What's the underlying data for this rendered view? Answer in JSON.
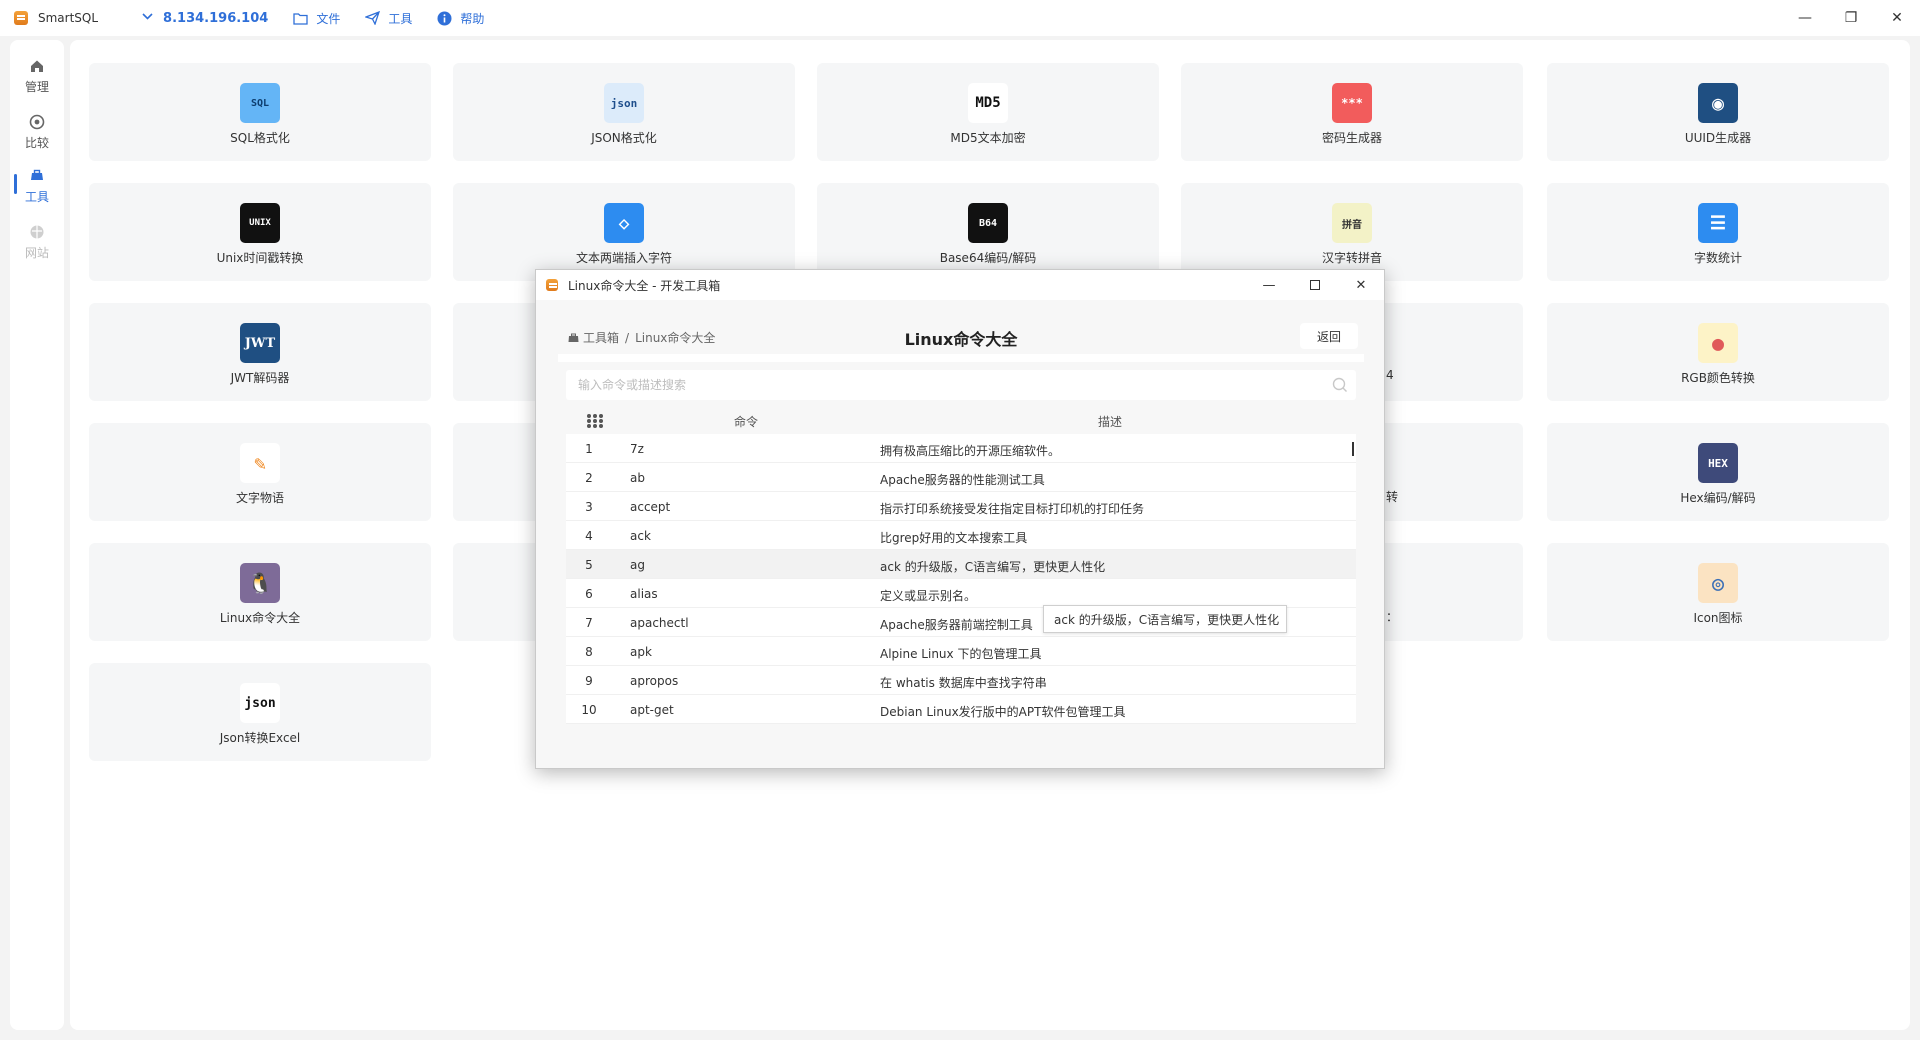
{
  "app": {
    "title": "SmartSQL",
    "connection": "8.134.196.104",
    "menu": [
      {
        "label": "文件",
        "icon": "folder-icon"
      },
      {
        "label": "工具",
        "icon": "send-icon"
      },
      {
        "label": "帮助",
        "icon": "info-icon"
      }
    ],
    "window_controls": {
      "minimize": "—",
      "restore": "❐",
      "close": "✕"
    }
  },
  "rail": {
    "items": [
      {
        "label": "管理",
        "icon": "home-icon",
        "state": "normal"
      },
      {
        "label": "比较",
        "icon": "compass-icon",
        "state": "normal"
      },
      {
        "label": "工具",
        "icon": "toolbox-icon",
        "state": "active"
      },
      {
        "label": "网站",
        "icon": "globe-icon",
        "state": "disabled"
      }
    ]
  },
  "tools": [
    {
      "label": "SQL格式化",
      "icon": "sql-format-icon",
      "icon_text": "SQL",
      "icon_bg": "#64b5f6",
      "icon_fg": "#0d3d6e"
    },
    {
      "label": "JSON格式化",
      "icon": "json-format-icon",
      "icon_text": "json",
      "icon_bg": "#dcebfa",
      "icon_fg": "#1e4e8c"
    },
    {
      "label": "MD5文本加密",
      "icon": "md5-icon",
      "icon_text": "MD5",
      "icon_bg": "#ffffff",
      "icon_fg": "#111111"
    },
    {
      "label": "密码生成器",
      "icon": "password-generator-icon",
      "icon_text": "***",
      "icon_bg": "#f25c5c",
      "icon_fg": "#ffffff"
    },
    {
      "label": "UUID生成器",
      "icon": "uuid-icon",
      "icon_text": "◉",
      "icon_bg": "#1f4f82",
      "icon_fg": "#ffffff"
    },
    {
      "label": "Unix时间戳转换",
      "icon": "unix-timestamp-icon",
      "icon_text": "UNIX",
      "icon_bg": "#111111",
      "icon_fg": "#ffffff"
    },
    {
      "label": "文本两端插入字符",
      "icon": "eraser-icon",
      "icon_text": "◇",
      "icon_bg": "#2d8cf0",
      "icon_fg": "#ffffff"
    },
    {
      "label": "Base64编码/解码",
      "icon": "base64-icon",
      "icon_text": "B64",
      "icon_bg": "#111111",
      "icon_fg": "#ffffff"
    },
    {
      "label": "汉字转拼音",
      "icon": "pinyin-icon",
      "icon_text": "拼音",
      "icon_bg": "#f3f2c7",
      "icon_fg": "#333333"
    },
    {
      "label": "字数统计",
      "icon": "word-count-icon",
      "icon_text": "☰",
      "icon_bg": "#2d8cf0",
      "icon_fg": "#ffffff"
    },
    {
      "label": "JWT解码器",
      "icon": "jwt-icon",
      "icon_text": "JWT",
      "icon_bg": "#1f4f82",
      "icon_fg": "#ffffff"
    },
    {
      "label": "RGB颜色转换",
      "icon": "palette-icon",
      "icon_text": "●",
      "icon_bg": "#fdf3c7",
      "icon_fg": "#e05a5a"
    },
    {
      "label": "文字物语",
      "icon": "text-story-icon",
      "icon_text": "✎",
      "icon_bg": "#ffffff",
      "icon_fg": "#f08a24"
    },
    {
      "label": "Hex编码/解码",
      "icon": "hex-icon",
      "icon_text": "HEX",
      "icon_bg": "#3e4a7a",
      "icon_fg": "#ffffff"
    },
    {
      "label": "Linux命令大全",
      "icon": "linux-penguin-icon",
      "icon_text": "🐧",
      "icon_bg": "#7e6b98",
      "icon_fg": "#ffffff"
    },
    {
      "label": "Icon图标",
      "icon": "icon-library-icon",
      "icon_text": "◎",
      "icon_bg": "#fbe3c2",
      "icon_fg": "#3b6fb6"
    },
    {
      "label": "Json转换Excel",
      "icon": "json-to-excel-icon",
      "icon_text": "json",
      "icon_bg": "#ffffff",
      "icon_fg": "#111111"
    }
  ],
  "peek_fragments": [
    "4",
    "转",
    "："
  ],
  "dialog": {
    "title": "Linux命令大全 - 开发工具箱",
    "breadcrumb_root": "工具箱",
    "breadcrumb_sep": "/",
    "breadcrumb_current": "Linux命令大全",
    "heading": "Linux命令大全",
    "back_label": "返回",
    "search_placeholder": "输入命令或描述搜索",
    "col_command": "命令",
    "col_description": "描述",
    "rows": [
      {
        "idx": "1",
        "cmd": "7z",
        "desc": "拥有极高压缩比的开源压缩软件。"
      },
      {
        "idx": "2",
        "cmd": "ab",
        "desc": "Apache服务器的性能测试工具"
      },
      {
        "idx": "3",
        "cmd": "accept",
        "desc": "指示打印系统接受发往指定目标打印机的打印任务"
      },
      {
        "idx": "4",
        "cmd": "ack",
        "desc": "比grep好用的文本搜索工具"
      },
      {
        "idx": "5",
        "cmd": "ag",
        "desc": "ack 的升级版，C语言编写，更快更人性化"
      },
      {
        "idx": "6",
        "cmd": "alias",
        "desc": "定义或显示别名。"
      },
      {
        "idx": "7",
        "cmd": "apachectl",
        "desc": "Apache服务器前端控制工具"
      },
      {
        "idx": "8",
        "cmd": "apk",
        "desc": "Alpine Linux 下的包管理工具"
      },
      {
        "idx": "9",
        "cmd": "apropos",
        "desc": "在 whatis 数据库中查找字符串"
      },
      {
        "idx": "10",
        "cmd": "apt-get",
        "desc": "Debian Linux发行版中的APT软件包管理工具"
      }
    ],
    "hovered_row": "5",
    "tooltip": "ack 的升级版，C语言编写，更快更人性化"
  },
  "colors": {
    "accent": "#2f6fd8"
  }
}
